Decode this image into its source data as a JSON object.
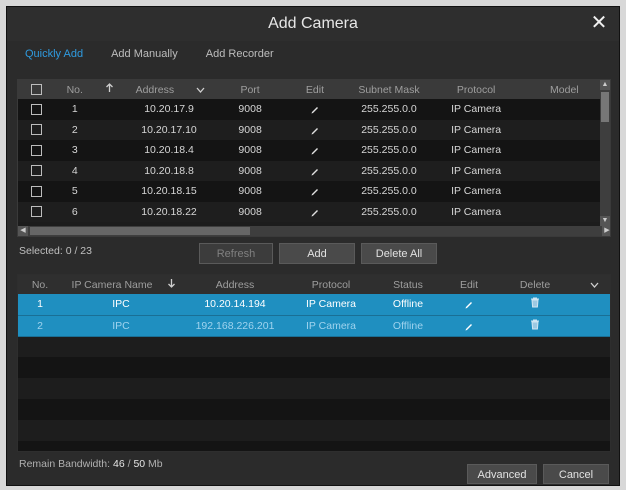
{
  "dialog": {
    "title": "Add Camera"
  },
  "tabs": [
    {
      "label": "Quickly Add"
    },
    {
      "label": "Add Manually"
    },
    {
      "label": "Add Recorder"
    }
  ],
  "top_table": {
    "columns": [
      "",
      "No.",
      "",
      "Address",
      "",
      "Port",
      "Edit",
      "Subnet Mask",
      "Protocol",
      "Model"
    ],
    "rows": [
      {
        "no": "1",
        "address": "10.20.17.9",
        "port": "9008",
        "subnet": "255.255.0.0",
        "protocol": "IP Camera",
        "model": ""
      },
      {
        "no": "2",
        "address": "10.20.17.10",
        "port": "9008",
        "subnet": "255.255.0.0",
        "protocol": "IP Camera",
        "model": ""
      },
      {
        "no": "3",
        "address": "10.20.18.4",
        "port": "9008",
        "subnet": "255.255.0.0",
        "protocol": "IP Camera",
        "model": ""
      },
      {
        "no": "4",
        "address": "10.20.18.8",
        "port": "9008",
        "subnet": "255.255.0.0",
        "protocol": "IP Camera",
        "model": ""
      },
      {
        "no": "5",
        "address": "10.20.18.15",
        "port": "9008",
        "subnet": "255.255.0.0",
        "protocol": "IP Camera",
        "model": ""
      },
      {
        "no": "6",
        "address": "10.20.18.22",
        "port": "9008",
        "subnet": "255.255.0.0",
        "protocol": "IP Camera",
        "model": ""
      }
    ]
  },
  "selected": "Selected: 0 / 23",
  "buttons": {
    "refresh": "Refresh",
    "add": "Add",
    "delete_all": "Delete All",
    "advanced": "Advanced",
    "cancel": "Cancel"
  },
  "bottom_table": {
    "columns": [
      "No.",
      "IP Camera Name",
      "",
      "Address",
      "Protocol",
      "Status",
      "Edit",
      "Delete"
    ],
    "rows": [
      {
        "no": "1",
        "name": "IPC",
        "address": "10.20.14.194",
        "protocol": "IP Camera",
        "status": "Offline"
      },
      {
        "no": "2",
        "name": "IPC",
        "address": "192.168.226.201",
        "protocol": "IP Camera",
        "status": "Offline"
      }
    ]
  },
  "bandwidth": {
    "label": "Remain Bandwidth:",
    "used": "46",
    "sep": "/",
    "total": "50",
    "unit": "Mb"
  },
  "colors": {
    "accent": "#2f9be0",
    "selection": "#1f8fc0",
    "background": "#2b2b2b"
  },
  "icons": {
    "close": "close-icon",
    "edit": "pencil-icon",
    "delete": "trash-icon",
    "sort": "sort-arrow-icon"
  }
}
